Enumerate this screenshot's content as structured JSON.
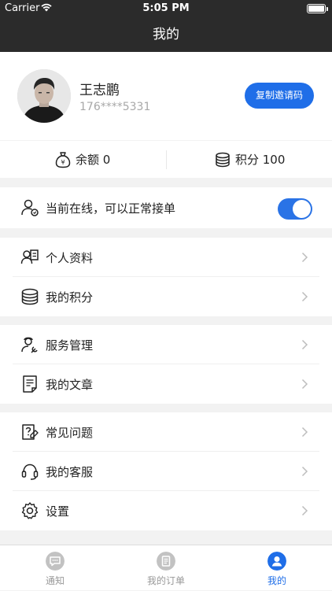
{
  "status_bar": {
    "carrier": "Carrier",
    "time": "5:05 PM"
  },
  "nav": {
    "title": "我的"
  },
  "profile": {
    "name": "王志鹏",
    "phone": "176****5331",
    "invite_button": "复制邀请码"
  },
  "balance": {
    "balance_label": "余额 0",
    "points_label": "积分 100"
  },
  "online": {
    "label": "当前在线，可以正常接单",
    "enabled": true
  },
  "menu": {
    "personal_info": "个人资料",
    "my_points": "我的积分",
    "service_management": "服务管理",
    "my_articles": "我的文章",
    "faq": "常见问题",
    "customer_service": "我的客服",
    "settings": "设置"
  },
  "tabs": [
    {
      "label": "通知",
      "icon": "message-icon",
      "active": false
    },
    {
      "label": "我的订单",
      "icon": "order-list-icon",
      "active": false
    },
    {
      "label": "我的",
      "icon": "user-icon",
      "active": true
    }
  ],
  "colors": {
    "accent": "#1f6ee8",
    "header": "#2b2b2b"
  }
}
